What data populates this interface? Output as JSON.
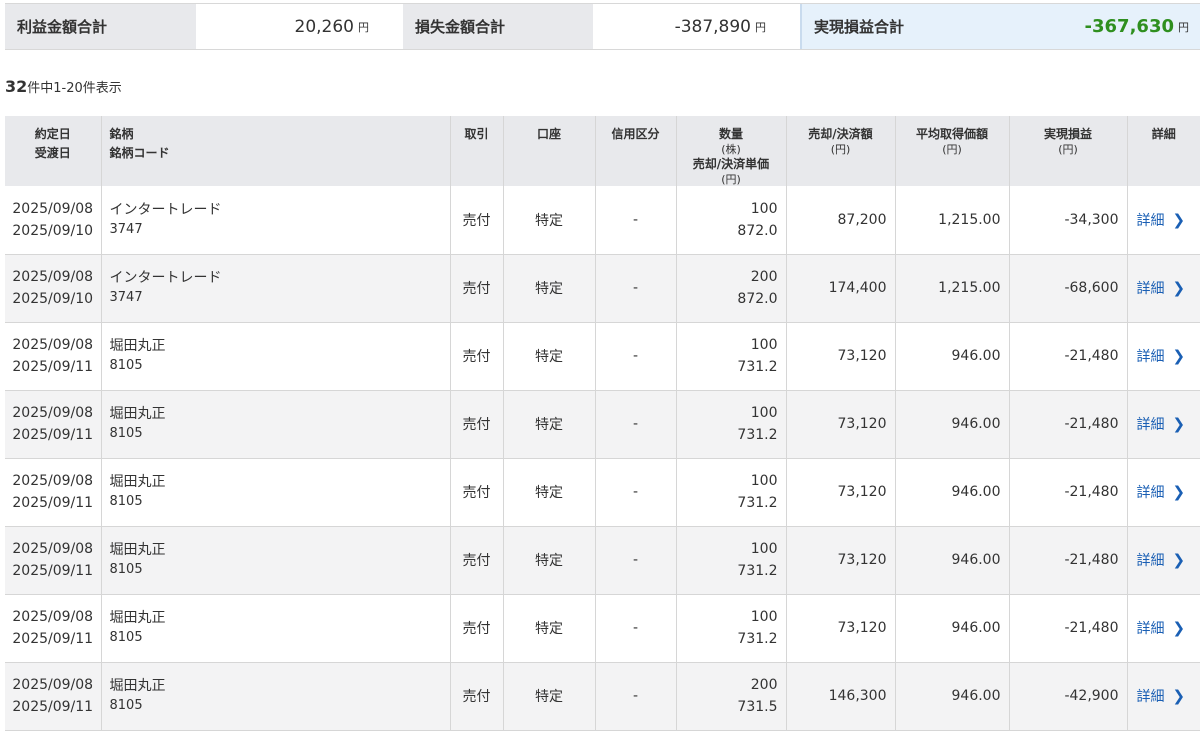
{
  "summary": {
    "profit_label": "利益金額合計",
    "profit_value": "20,260",
    "loss_label": "損失金額合計",
    "loss_value": "-387,890",
    "realized_label": "実現損益合計",
    "realized_value": "-367,630",
    "unit": "円",
    "realized_color": "#2f8f1f"
  },
  "count": {
    "total": "32",
    "text": "件中1-20件表示"
  },
  "columns": {
    "date1": "約定日",
    "date2": "受渡日",
    "name1": "銘柄",
    "name2": "銘柄コード",
    "trade": "取引",
    "account": "口座",
    "credit": "信用区分",
    "qty1": "数量",
    "qty_unit": "(株)",
    "qty2": "売却/決済単価",
    "qty2_unit": "(円)",
    "amount": "売却/決済額",
    "amount_unit": "(円)",
    "avg": "平均取得価額",
    "avg_unit": "(円)",
    "pl": "実現損益",
    "pl_unit": "(円)",
    "detail": "詳細"
  },
  "rows": [
    {
      "trade_date": "2025/09/08",
      "settle_date": "2025/09/10",
      "name": "インタートレード",
      "code": "3747",
      "trade": "売付",
      "account": "特定",
      "credit": "-",
      "qty": "100",
      "price": "872.0",
      "amount": "87,200",
      "avg": "1,215.00",
      "pl": "-34,300",
      "detail": "詳細"
    },
    {
      "trade_date": "2025/09/08",
      "settle_date": "2025/09/10",
      "name": "インタートレード",
      "code": "3747",
      "trade": "売付",
      "account": "特定",
      "credit": "-",
      "qty": "200",
      "price": "872.0",
      "amount": "174,400",
      "avg": "1,215.00",
      "pl": "-68,600",
      "detail": "詳細"
    },
    {
      "trade_date": "2025/09/08",
      "settle_date": "2025/09/11",
      "name": "堀田丸正",
      "code": "8105",
      "trade": "売付",
      "account": "特定",
      "credit": "-",
      "qty": "100",
      "price": "731.2",
      "amount": "73,120",
      "avg": "946.00",
      "pl": "-21,480",
      "detail": "詳細"
    },
    {
      "trade_date": "2025/09/08",
      "settle_date": "2025/09/11",
      "name": "堀田丸正",
      "code": "8105",
      "trade": "売付",
      "account": "特定",
      "credit": "-",
      "qty": "100",
      "price": "731.2",
      "amount": "73,120",
      "avg": "946.00",
      "pl": "-21,480",
      "detail": "詳細"
    },
    {
      "trade_date": "2025/09/08",
      "settle_date": "2025/09/11",
      "name": "堀田丸正",
      "code": "8105",
      "trade": "売付",
      "account": "特定",
      "credit": "-",
      "qty": "100",
      "price": "731.2",
      "amount": "73,120",
      "avg": "946.00",
      "pl": "-21,480",
      "detail": "詳細"
    },
    {
      "trade_date": "2025/09/08",
      "settle_date": "2025/09/11",
      "name": "堀田丸正",
      "code": "8105",
      "trade": "売付",
      "account": "特定",
      "credit": "-",
      "qty": "100",
      "price": "731.2",
      "amount": "73,120",
      "avg": "946.00",
      "pl": "-21,480",
      "detail": "詳細"
    },
    {
      "trade_date": "2025/09/08",
      "settle_date": "2025/09/11",
      "name": "堀田丸正",
      "code": "8105",
      "trade": "売付",
      "account": "特定",
      "credit": "-",
      "qty": "100",
      "price": "731.2",
      "amount": "73,120",
      "avg": "946.00",
      "pl": "-21,480",
      "detail": "詳細"
    },
    {
      "trade_date": "2025/09/08",
      "settle_date": "2025/09/11",
      "name": "堀田丸正",
      "code": "8105",
      "trade": "売付",
      "account": "特定",
      "credit": "-",
      "qty": "200",
      "price": "731.5",
      "amount": "146,300",
      "avg": "946.00",
      "pl": "-42,900",
      "detail": "詳細"
    }
  ],
  "colors": {
    "profit_loss_text": "#2f8f1f",
    "link": "#1a5fb4",
    "header_bg": "#e8e9ec",
    "highlight_bg": "#e6f1fb"
  },
  "icons": {
    "detail_chevron": "chevron-right-icon"
  }
}
